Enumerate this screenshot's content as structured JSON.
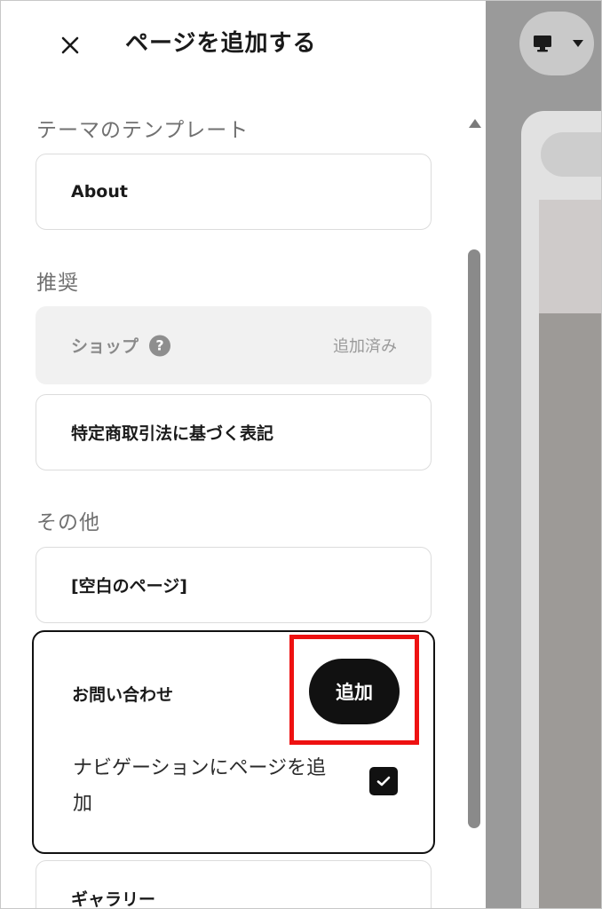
{
  "header": {
    "title": "ページを追加する",
    "close_icon": "close-icon"
  },
  "sections": {
    "theme_templates": {
      "label": "テーマのテンプレート",
      "items": [
        {
          "label": "About"
        }
      ]
    },
    "recommended": {
      "label": "推奨",
      "items": [
        {
          "label": "ショップ",
          "help_icon": "?",
          "status": "追加済み",
          "disabled": true
        },
        {
          "label": "特定商取引法に基づく表記"
        }
      ]
    },
    "other": {
      "label": "その他",
      "items": [
        {
          "label": "[空白のページ]"
        },
        {
          "label": "お問い合わせ",
          "add_button_label": "追加",
          "nav_option_label": "ナビゲーションにページを追加",
          "nav_option_checked": true
        },
        {
          "label": "ギャラリー"
        }
      ]
    }
  },
  "preview": {
    "device_icon": "desktop-icon",
    "dropdown_icon": "caret-down-icon"
  },
  "colors": {
    "accent": "#111111",
    "highlight": "#ee1111",
    "muted_text": "#707070",
    "disabled_bg": "#f1f1f1",
    "preview_bg": "#9a9a9a"
  }
}
